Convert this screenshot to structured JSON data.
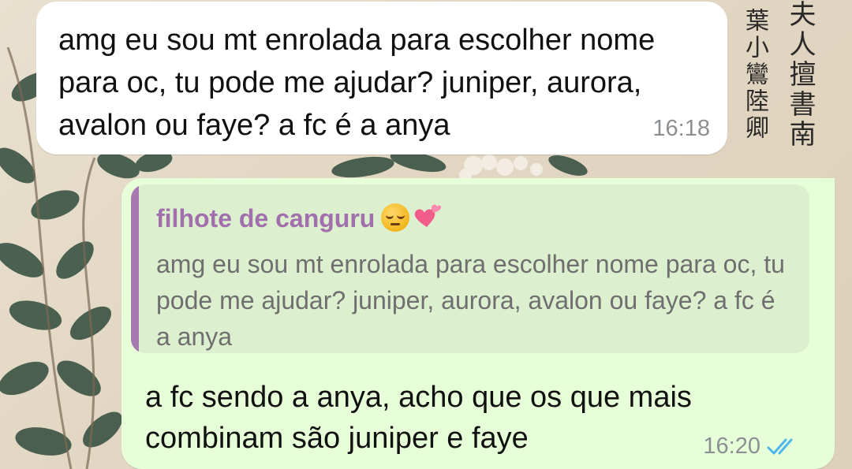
{
  "messages": [
    {
      "direction": "incoming",
      "text": "amg eu sou mt enrolada para escolher nome para oc, tu pode me ajudar? juniper, aurora, avalon ou faye? a fc é a anya",
      "time": "16:18"
    },
    {
      "direction": "outgoing",
      "quoted": {
        "author": "filhote de canguru",
        "author_emojis": [
          "pensive-face-emoji",
          "two-hearts-emoji"
        ],
        "text": "amg eu sou mt enrolada para escolher nome para oc, tu pode me ajudar? juniper, aurora, avalon ou faye? a fc é a anya"
      },
      "text": "a fc sendo a anya, acho que os que mais combinam são juniper e faye",
      "time": "16:20",
      "status_icon": "double-check-read-icon"
    }
  ],
  "wallpaper": {
    "calligraphy_col1": "夫人擅書南",
    "calligraphy_col2": "葉小鸞陸卿"
  },
  "colors": {
    "incoming_bubble": "#ffffff",
    "outgoing_bubble": "#e7ffd9",
    "quote_background": "#dcefcf",
    "quote_bar": "#a779b1",
    "quote_author": "#a16fab",
    "read_ticks": "#4fb6ec",
    "timestamp": "#8b8f92"
  }
}
